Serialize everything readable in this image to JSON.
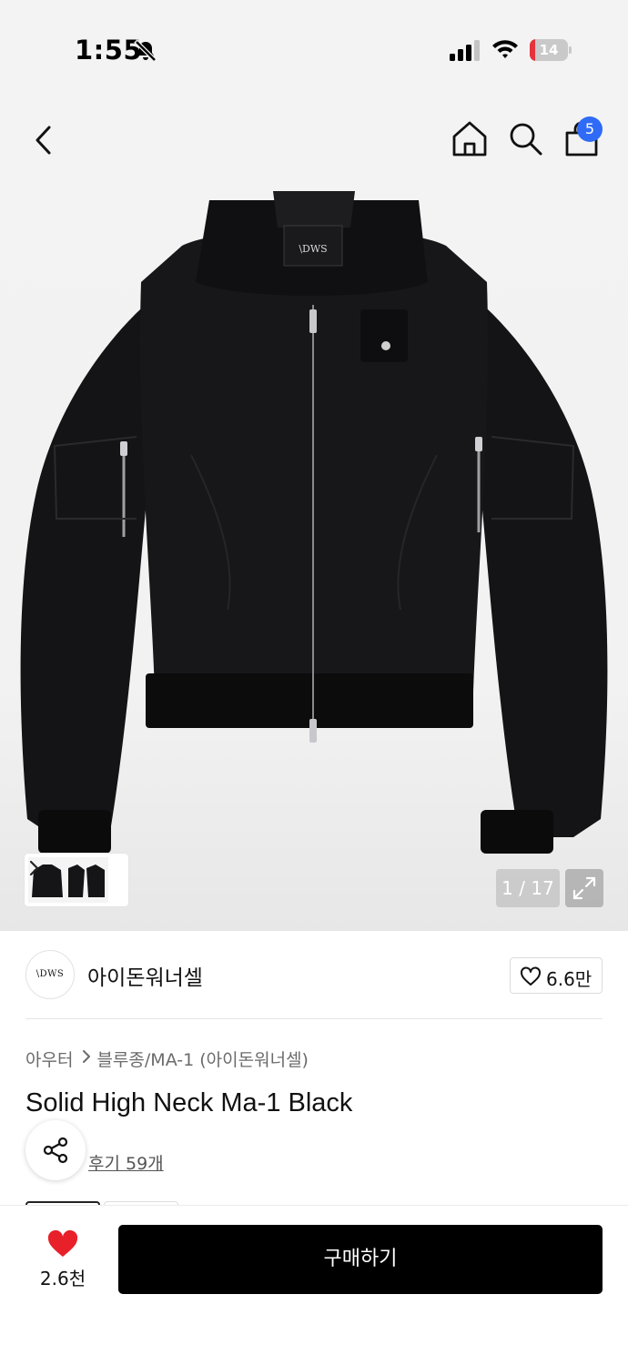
{
  "status_bar": {
    "time": "1:55",
    "battery_level": "14",
    "battery_fraction": 0.14,
    "icons": [
      "bell-slash-icon",
      "cellular-signal-icon",
      "wifi-icon",
      "battery-icon"
    ]
  },
  "top_nav": {
    "icons": [
      "chevron-left-icon",
      "home-icon",
      "search-icon",
      "shopping-bag-icon"
    ],
    "cart_count": "5"
  },
  "gallery": {
    "counter": "1 / 17",
    "collar_label": "\\DWS",
    "thumbnail_icon": "chevron-right-icon",
    "expand_icon": "expand-icon"
  },
  "brand": {
    "logo_text": "\\DWS",
    "name": "아이돈워너셀",
    "like_count": "6.6만"
  },
  "breadcrumb": {
    "category": "아우터",
    "subcategory": "블루종/MA-1 (아이돈워너셀)"
  },
  "product": {
    "title": "Solid High Neck Ma-1 Black",
    "review_link": "후기 59개"
  },
  "bottom_bar": {
    "wish_count": "2.6천",
    "buy_label": "구매하기"
  },
  "colors": {
    "accent_blue": "#2f6bf6",
    "heart_red": "#e8202a",
    "buy_button": "#000000",
    "battery_low": "#e5333a"
  }
}
